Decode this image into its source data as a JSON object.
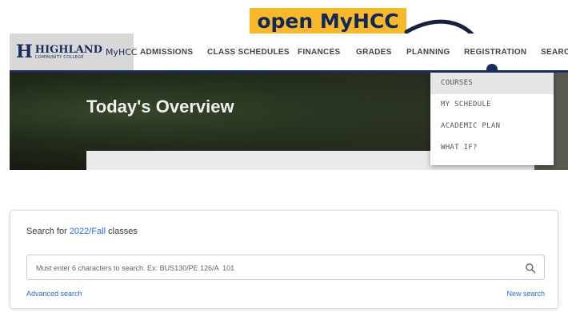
{
  "callout": {
    "text": "open MyHCC"
  },
  "logo": {
    "letter": "H",
    "word": "HIGHLAND",
    "subword": "COMMUNITY COLLEGE",
    "product": "MyHCC"
  },
  "nav": {
    "items": [
      "ADMISSIONS",
      "CLASS SCHEDULES",
      "FINANCES",
      "GRADES",
      "PLANNING",
      "REGISTRATION",
      "SEARCH"
    ]
  },
  "hero": {
    "title": "Today's Overview"
  },
  "registration_menu": {
    "items": [
      "COURSES",
      "MY SCHEDULE",
      "ACADEMIC PLAN",
      "WHAT IF?"
    ],
    "active": "COURSES"
  },
  "search": {
    "heading_prefix": "Search for",
    "term": "2022/Fall",
    "heading_suffix": "classes",
    "placeholder": "Must enter 6 characters to search. Ex: BUS130/PE 126/A  101",
    "icon": "search-icon",
    "advanced_label": "Advanced search",
    "new_label": "New search"
  },
  "colors": {
    "brand_navy": "#1b2d5a",
    "callout_yellow": "#f7b82b",
    "link_blue": "#2a6bd3"
  }
}
